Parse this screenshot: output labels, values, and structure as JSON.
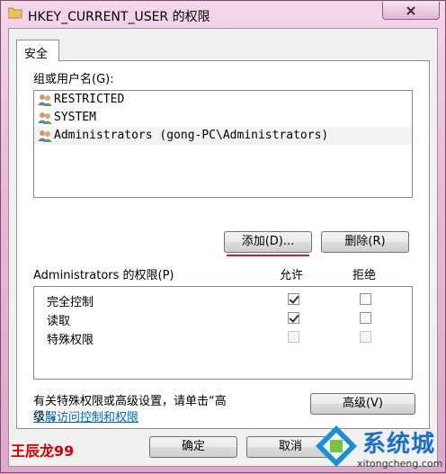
{
  "window": {
    "title": "HKEY_CURRENT_USER 的权限",
    "close_icon": "close-icon"
  },
  "tabs": [
    {
      "label": "安全",
      "active": true
    }
  ],
  "users_section": {
    "label": "组或用户名(G):",
    "items": [
      {
        "name": "RESTRICTED",
        "icon": "user-group-icon",
        "selected": false
      },
      {
        "name": "SYSTEM",
        "icon": "user-group-icon",
        "selected": false
      },
      {
        "name": "Administrators (gong-PC\\Administrators)",
        "icon": "user-group-icon",
        "selected": true
      }
    ]
  },
  "buttons": {
    "add": "添加(D)...",
    "remove": "删除(R)",
    "advanced": "高级(V)",
    "ok": "确定",
    "cancel": "取消"
  },
  "permissions": {
    "title": "Administrators 的权限(P)",
    "allow_header": "允许",
    "deny_header": "拒绝",
    "rows": [
      {
        "name": "完全控制",
        "allow": true,
        "deny": false,
        "enabled": true
      },
      {
        "name": "读取",
        "allow": true,
        "deny": false,
        "enabled": true
      },
      {
        "name": "特殊权限",
        "allow": false,
        "deny": false,
        "enabled": false
      }
    ]
  },
  "advanced_hint_line1": "有关特殊权限或高级设置，请单击“高",
  "advanced_hint_line2": "级”。",
  "link_text": "了解访问控制和权限",
  "watermark": {
    "author": "王辰龙99",
    "site_name": "系统城",
    "site_url": "xitongcheng.com"
  },
  "colors": {
    "accent_red": "#d42020",
    "link_blue": "#0066cc",
    "frame_pink": "#e9b9d8"
  }
}
